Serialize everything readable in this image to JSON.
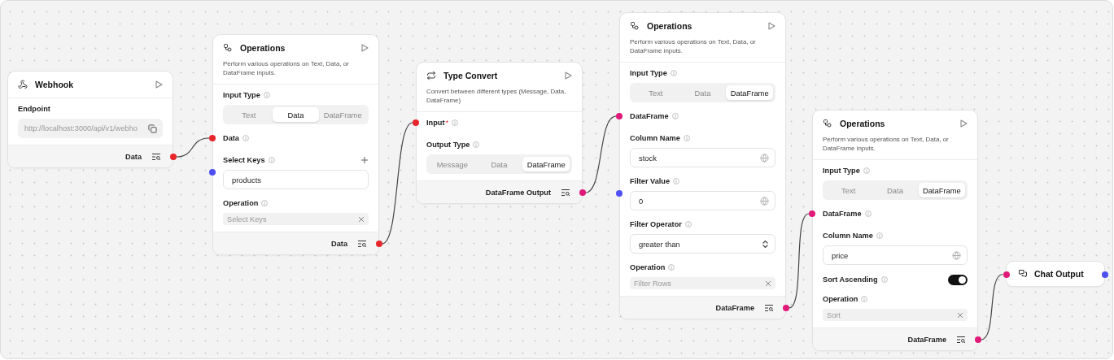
{
  "nodes": [
    {
      "kind": "component",
      "title": "Webhook",
      "fields": [
        {
          "kind": "endpoint",
          "label": "Endpoint",
          "info": false,
          "value": "http://localhost:3000/api/v1/webho"
        }
      ],
      "output": {
        "label": "Data",
        "color": "#e7262c"
      }
    },
    {
      "kind": "component",
      "title": "Operations",
      "description": "Perform various operations on Text, Data, or DataFrame inputs.",
      "fields": [
        {
          "kind": "segmented",
          "label": "Input Type",
          "info": true,
          "options": [
            {
              "label": "Text",
              "selected": false
            },
            {
              "label": "Data",
              "selected": true
            },
            {
              "label": "DataFrame",
              "selected": false
            }
          ]
        },
        {
          "kind": "handle",
          "label": "Data",
          "info": true,
          "color": "#e7262c"
        },
        {
          "kind": "list",
          "label": "Select Keys",
          "info": true,
          "color": "#4e4ef5",
          "value": "products"
        },
        {
          "kind": "chip",
          "label": "Operation",
          "info": true,
          "value": "Select Keys"
        }
      ],
      "output": {
        "label": "Data",
        "color": "#e7262c"
      }
    },
    {
      "kind": "component",
      "title": "Type Convert",
      "description": "Convert between different types (Message, Data, DataFrame)",
      "fields": [
        {
          "kind": "handle",
          "label": "Input",
          "mark": "*",
          "info": true,
          "color": "#e7262c"
        },
        {
          "kind": "segmented",
          "label": "Output Type",
          "info": true,
          "options": [
            {
              "label": "Message",
              "selected": false
            },
            {
              "label": "Data",
              "selected": false
            },
            {
              "label": "DataFrame",
              "selected": true
            }
          ]
        }
      ],
      "output": {
        "label": "DataFrame Output",
        "color": "#e0197a"
      }
    },
    {
      "kind": "component",
      "title": "Operations",
      "description": "Perform various operations on Text, Data, or DataFrame inputs.",
      "fields": [
        {
          "kind": "segmented",
          "label": "Input Type",
          "info": true,
          "options": [
            {
              "label": "Text",
              "selected": false
            },
            {
              "label": "Data",
              "selected": false
            },
            {
              "label": "DataFrame",
              "selected": true
            }
          ]
        },
        {
          "kind": "handle",
          "label": "DataFrame",
          "info": true,
          "color": "#e0197a"
        },
        {
          "kind": "text",
          "label": "Column Name",
          "info": true,
          "value": "stock"
        },
        {
          "kind": "text",
          "label": "Filter Value",
          "info": true,
          "value": "0",
          "color": "#4e4ef5"
        },
        {
          "kind": "select",
          "label": "Filter Operator",
          "info": true,
          "value": "greater than"
        },
        {
          "kind": "chip",
          "label": "Operation",
          "info": true,
          "value": "Filter Rows"
        }
      ],
      "output": {
        "label": "DataFrame",
        "color": "#e0197a"
      }
    },
    {
      "kind": "component",
      "title": "Operations",
      "description": "Perform various operations on Text, Data, or DataFrame inputs.",
      "fields": [
        {
          "kind": "segmented",
          "label": "Input Type",
          "info": true,
          "options": [
            {
              "label": "Text",
              "selected": false
            },
            {
              "label": "Data",
              "selected": false
            },
            {
              "label": "DataFrame",
              "selected": true
            }
          ]
        },
        {
          "kind": "handle",
          "label": "DataFrame",
          "info": true,
          "color": "#e0197a"
        },
        {
          "kind": "text",
          "label": "Column Name",
          "info": true,
          "value": "price"
        },
        {
          "kind": "toggle",
          "label": "Sort Ascending",
          "info": true,
          "on": true
        },
        {
          "kind": "chip",
          "label": "Operation",
          "info": true,
          "value": "Sort"
        }
      ],
      "output": {
        "label": "DataFrame",
        "color": "#e0197a"
      }
    },
    {
      "kind": "compact",
      "title": "Chat Output",
      "input": {
        "color": "#e0197a"
      },
      "output": {
        "color": "#4e4ef5"
      }
    }
  ]
}
